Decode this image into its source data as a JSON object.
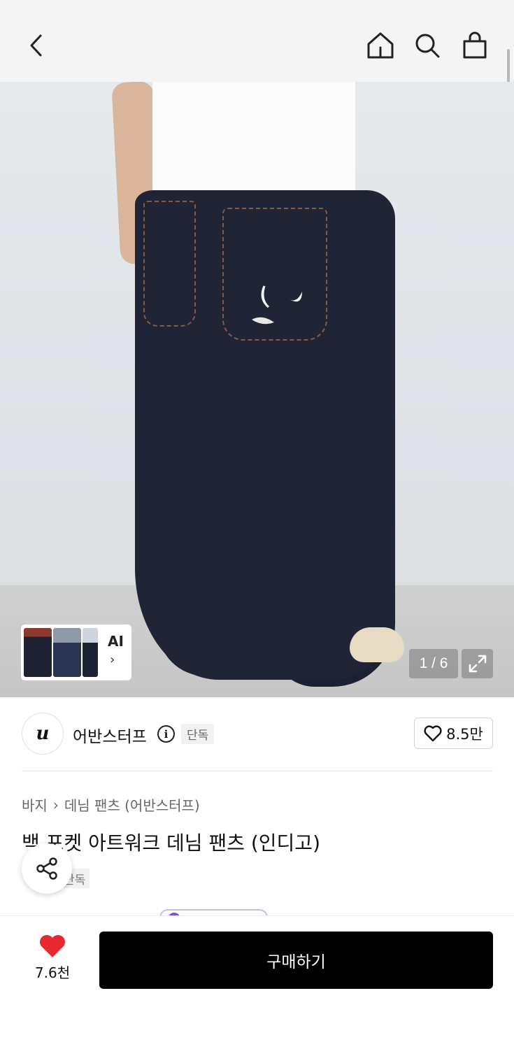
{
  "header": {
    "icons": [
      "back-arrow-icon",
      "home-icon",
      "search-icon",
      "shopping-bag-icon"
    ]
  },
  "gallery": {
    "counter": "1 / 6",
    "ai_label": "AI",
    "ai_chevron": "›",
    "expand_icon": "expand-icon"
  },
  "brand": {
    "logo_text": "u",
    "name": "어반스터프",
    "info_icon": "i",
    "exclusive_badge": "단독",
    "like_count": "8.5만"
  },
  "product": {
    "breadcrumb": [
      "바지",
      "데님 팬츠 (어반스터프)"
    ],
    "breadcrumb_separator": "›",
    "title": "백 포켓 아트워크 데님 팬츠 (인디고)",
    "sub_badge": "단독"
  },
  "bottom_bar": {
    "heart_count": "7.6천",
    "buy_label": "구매하기"
  },
  "colors": {
    "accent_heart": "#e8292f",
    "buy_button_bg": "#000000",
    "header_bg": "#f4f4f4"
  }
}
